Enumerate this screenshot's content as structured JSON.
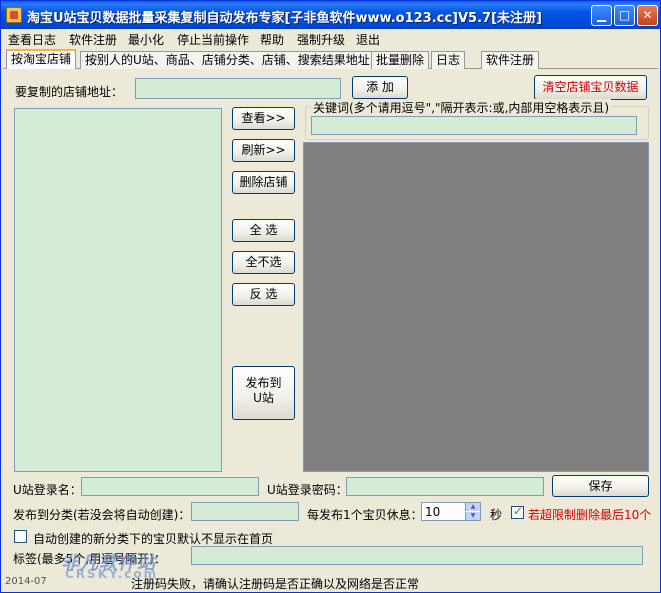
{
  "window": {
    "title": "淘宝U站宝贝数据批量采集复制自动发布专家[子非鱼软件www.o123.cc]V5.7[未注册]",
    "min_icon": "minimize-icon",
    "max_icon": "maximize-icon",
    "close_icon": "close-icon"
  },
  "menu": [
    "查看日志",
    "软件注册",
    "最小化",
    "停止当前操作",
    "帮助",
    "强制升级",
    "退出"
  ],
  "tabs": [
    "按淘宝店铺",
    "按别人的U站、商品、店铺分类、店铺、搜索结果地址",
    "批量删除",
    "日志",
    "软件注册"
  ],
  "main": {
    "store_url_label": "要复制的店铺地址：",
    "store_url_value": "",
    "add_button": "添  加",
    "clear_button": "清空店铺宝贝数据",
    "view_button": "查看>>",
    "refresh_button": "刷新>>",
    "delete_store_button": "删除店铺",
    "select_all_button": "全  选",
    "select_none_button": "全不选",
    "invert_button": "反  选",
    "publish_button": "发布到\nU站",
    "keyword_group_label": "关键词(多个请用逗号\",\"隔开表示:或,内部用空格表示且)",
    "keyword_value": ""
  },
  "bottom": {
    "login_label": "U站登录名：",
    "login_value": "",
    "password_label": "U站登录密码：",
    "password_value": "",
    "save_button": "保存",
    "category_label": "发布到分类(若没会将自动创建)：",
    "category_value": "",
    "rest_label": "每发布1个宝贝休息：",
    "rest_value": "10",
    "seconds_label": "秒",
    "limit_delete_checked": true,
    "limit_delete_label": "若超限制删除最后10个",
    "hide_new_cat_checked": false,
    "hide_new_cat_label": "自动创建的新分类下的宝贝默认不显示在首页",
    "tags_label": "标签(最多5个,用逗号隔开)：",
    "tags_value": "",
    "status_text": "注册码失败，请确认注册码是否正确以及网络是否正常",
    "timestamp": "2014-07"
  },
  "watermark": {
    "brand": "非凡软件站",
    "sub": "CRSKY.com"
  },
  "colors": {
    "title_bar": "#0054e3",
    "list_bg": "#d4ebd6",
    "grid_bg": "#808080",
    "warning_red": "#d40000"
  }
}
